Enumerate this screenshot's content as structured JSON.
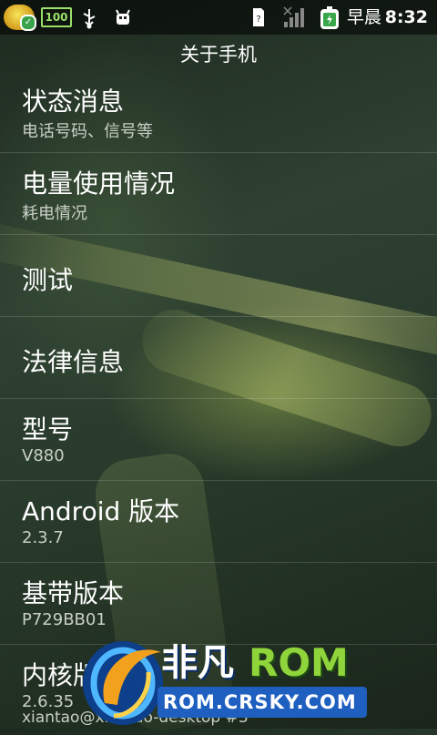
{
  "status_bar": {
    "battery_level": "100",
    "time": "8:32",
    "time_period": "早晨",
    "icons": [
      "app-badge-icon",
      "battery-icon",
      "usb-icon",
      "debug-icon",
      "sim-icon",
      "signal-icon",
      "charging-icon"
    ]
  },
  "header": {
    "title": "关于手机"
  },
  "items": [
    {
      "label": "状态消息",
      "sub": "电话号码、信号等"
    },
    {
      "label": "电量使用情况",
      "sub": "耗电情况"
    },
    {
      "label": "测试",
      "sub": ""
    },
    {
      "label": "法律信息",
      "sub": ""
    },
    {
      "label": "型号",
      "sub": "V880"
    },
    {
      "label": "Android 版本",
      "sub": "2.3.7"
    },
    {
      "label": "基带版本",
      "sub": "P729BB01"
    },
    {
      "label": "内核版本",
      "sub": "2.6.35",
      "sub2": "xiantao@xiantao-desktop #3"
    }
  ],
  "watermark": {
    "brand": "非凡",
    "rom": "ROM",
    "site": "ROM.CRSKY.COM"
  },
  "colors": {
    "battery": "#9be06a",
    "rom_text": "#8fd43a",
    "logo_blue": "#1e6fd0"
  }
}
